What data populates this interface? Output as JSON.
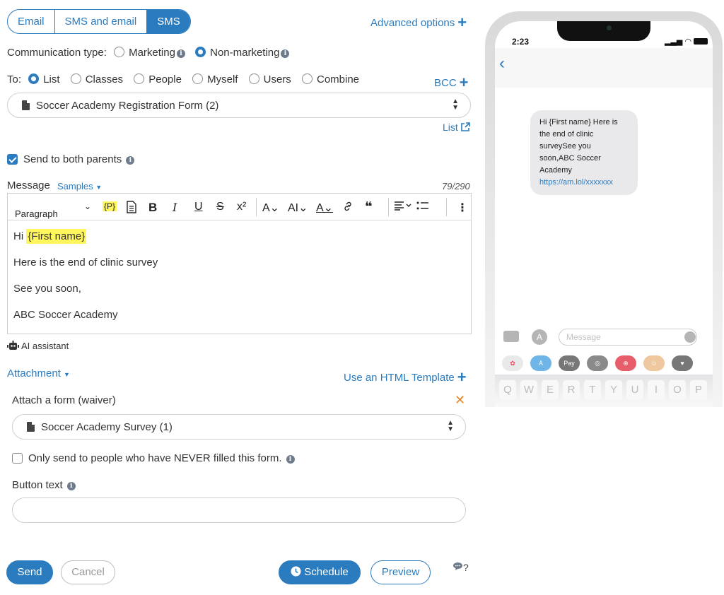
{
  "tabs": [
    "Email",
    "SMS and email",
    "SMS"
  ],
  "active_tab": "SMS",
  "advanced_options": "Advanced options",
  "communication": {
    "label": "Communication type:",
    "options": [
      "Marketing",
      "Non-marketing"
    ],
    "selected": "Non-marketing"
  },
  "to": {
    "label": "To:",
    "options": [
      "List",
      "Classes",
      "People",
      "Myself",
      "Users",
      "Combine"
    ],
    "selected": "List",
    "bcc": "BCC"
  },
  "list_select": {
    "value": "Soccer Academy Registration Form (2)",
    "link": "List"
  },
  "send_both_parents": "Send to both parents",
  "message": {
    "label": "Message",
    "samples": "Samples",
    "counter": "79/290",
    "toolbar": {
      "paragraph": "Paragraph",
      "placeholder_btn": "{P}"
    },
    "lines": {
      "hi": "Hi",
      "first_name": "{First name}",
      "line2": "Here is the end of clinic survey",
      "line3": "See you soon,",
      "line4": "ABC Soccer Academy"
    }
  },
  "ai_assistant": "AI assistant",
  "attachment": {
    "label": "Attachment",
    "html_template": "Use an HTML Template"
  },
  "form": {
    "title": "Attach a form (waiver)",
    "select_value": "Soccer Academy Survey (1)",
    "never_filled": "Only send to people who have NEVER filled this form.",
    "button_text_label": "Button text",
    "button_text_value": ""
  },
  "buttons": {
    "send": "Send",
    "cancel": "Cancel",
    "schedule": "Schedule",
    "preview": "Preview",
    "help": "?"
  },
  "phone": {
    "time": "2:23",
    "bubble_lines": [
      "Hi {First name} Here is",
      "the end of clinic",
      "surveySee you",
      "soon,ABC Soccer",
      "Academy"
    ],
    "bubble_link": "https://am.lol/xxxxxxx",
    "input_placeholder": "Message",
    "keys": [
      "Q",
      "W",
      "E",
      "R",
      "T",
      "Y",
      "U",
      "I",
      "O",
      "P"
    ]
  },
  "colors": {
    "accent": "#2b7bbf",
    "highlight": "#fff55c",
    "remove_x": "#e8862a"
  }
}
